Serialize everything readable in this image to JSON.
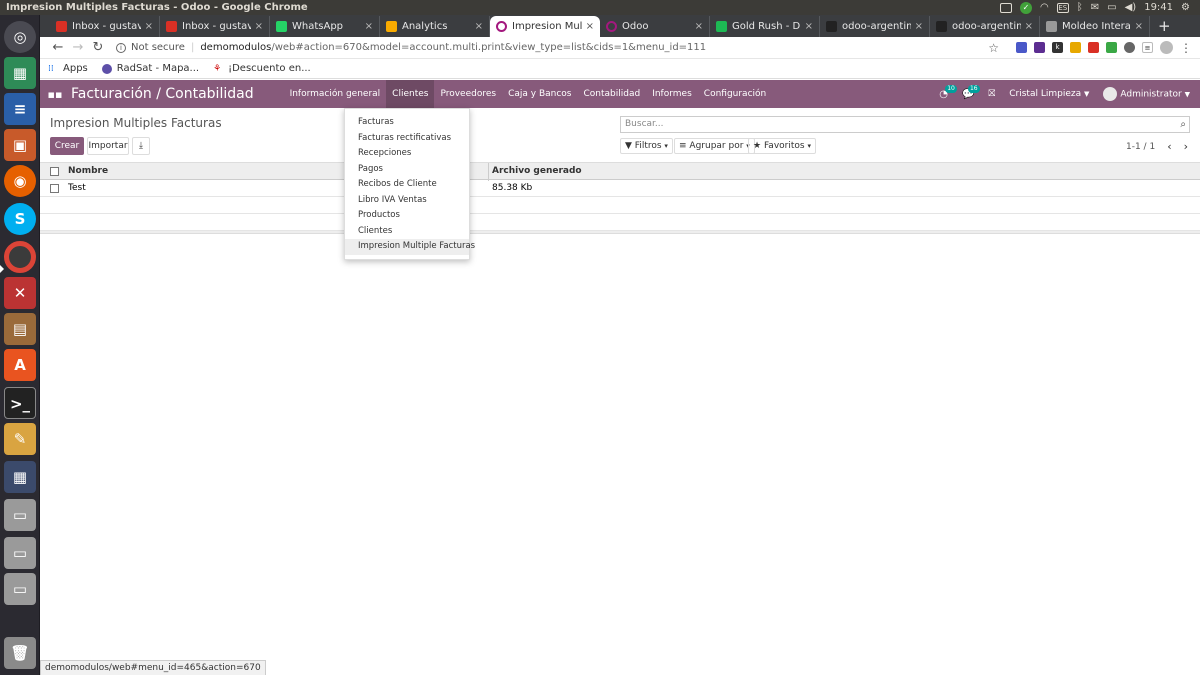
{
  "os": {
    "window_title": "Impresion Multiples Facturas - Odoo - Google Chrome",
    "tray_es": "ES",
    "clock": "19:41"
  },
  "tabs": [
    {
      "label": "Inbox - gustavo.",
      "icon": "gmail-icon",
      "color": "#d93025",
      "active": false
    },
    {
      "label": "Inbox - gustavo.",
      "icon": "gmail-icon",
      "color": "#d93025",
      "active": false
    },
    {
      "label": "WhatsApp",
      "icon": "whatsapp-icon",
      "color": "#25d366",
      "active": false
    },
    {
      "label": "Analytics",
      "icon": "analytics-icon",
      "color": "#f9ab00",
      "active": false
    },
    {
      "label": "Impresion Multi",
      "icon": "odoo-icon",
      "color": "#a3187e",
      "active": true
    },
    {
      "label": "Odoo",
      "icon": "odoo-icon",
      "color": "#a3187e",
      "active": false
    },
    {
      "label": "Gold Rush - D",
      "icon": "spotify-icon",
      "color": "#1db954",
      "active": false
    },
    {
      "label": "odoo-argentina",
      "icon": "github-icon",
      "color": "#222222",
      "active": false
    },
    {
      "label": "odoo-argentina",
      "icon": "github-icon",
      "color": "#222222",
      "active": false
    },
    {
      "label": "Moldeo Interact",
      "icon": "page-icon",
      "color": "#999999",
      "active": false
    }
  ],
  "addressbar": {
    "security": "Not secure",
    "url_host": "demomodulos",
    "url_path": "/web#action=670&model=account.multi.print&view_type=list&cids=1&menu_id=111"
  },
  "bookmarks": [
    {
      "label": "Apps",
      "icon": "apps-grid-icon"
    },
    {
      "label": "RadSat - Mapa...",
      "icon": "radsat-icon"
    },
    {
      "label": "¡Descuento en...",
      "icon": "bookmark-icon"
    }
  ],
  "odoo": {
    "brand": "Facturación / Contabilidad",
    "menu": [
      "Información general",
      "Clientes",
      "Proveedores",
      "Caja y Bancos",
      "Contabilidad",
      "Informes",
      "Configuración"
    ],
    "activity_count": "10",
    "message_count": "16",
    "company": "Cristal Limpieza",
    "user": "Administrator",
    "accent": "#875a7b"
  },
  "control": {
    "breadcrumb": "Impresion Multiples Facturas",
    "search_placeholder": "Buscar...",
    "create": "Crear",
    "import": "Importar",
    "filters": "Filtros",
    "group_by": "Agrupar por",
    "favorites": "Favoritos",
    "pager": "1-1 / 1"
  },
  "list": {
    "columns": [
      "Nombre",
      "Archivo generado"
    ],
    "rows": [
      {
        "name": "Test",
        "file": "85.38 Kb"
      }
    ]
  },
  "dropdown": {
    "items": [
      "Facturas",
      "Facturas rectificativas",
      "Recepciones",
      "Pagos",
      "Recibos de Cliente",
      "Libro IVA Ventas",
      "Productos",
      "Clientes",
      "Impresion Multiple Facturas"
    ],
    "active_index": 8
  },
  "status_url": "demomodulos/web#menu_id=465&action=670"
}
